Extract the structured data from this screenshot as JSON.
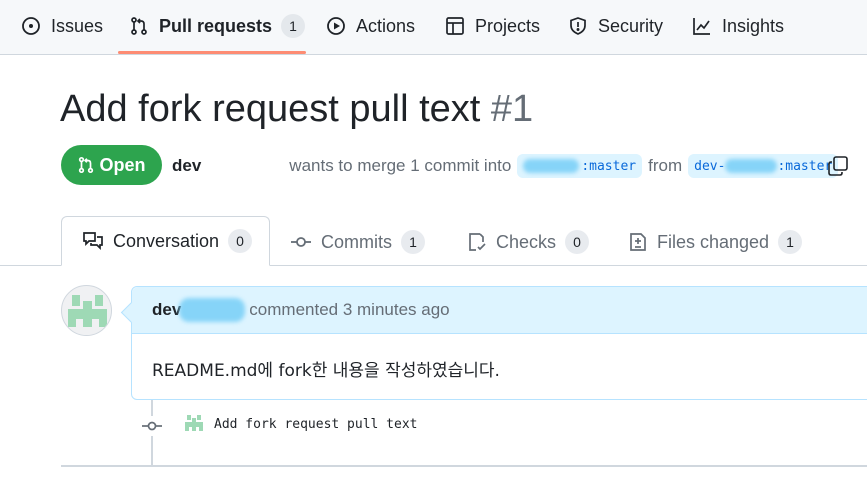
{
  "nav": {
    "items": [
      {
        "label": "Issues",
        "icon": "issue-opened-icon"
      },
      {
        "label": "Pull requests",
        "icon": "git-pull-request-icon",
        "count": "1",
        "selected": true
      },
      {
        "label": "Actions",
        "icon": "play-icon"
      },
      {
        "label": "Projects",
        "icon": "table-icon"
      },
      {
        "label": "Security",
        "icon": "shield-icon"
      },
      {
        "label": "Insights",
        "icon": "graph-icon"
      }
    ]
  },
  "pr": {
    "title": "Add fork request pull text",
    "number": "#1",
    "state": "Open",
    "author": "dev",
    "merge_text": "wants to merge 1 commit into",
    "base_branch": ":master",
    "from_text": "from",
    "head_branch_prefix": "dev-",
    "head_branch_suffix": ":master"
  },
  "tabs": [
    {
      "label": "Conversation",
      "count": "0",
      "icon": "comment-discussion-icon",
      "selected": true
    },
    {
      "label": "Commits",
      "count": "1",
      "icon": "git-commit-icon"
    },
    {
      "label": "Checks",
      "count": "0",
      "icon": "checklist-icon"
    },
    {
      "label": "Files changed",
      "count": "1",
      "icon": "file-diff-icon"
    }
  ],
  "comment": {
    "author": "dev",
    "meta": "commented 3 minutes ago",
    "body": "README.md에 fork한 내용을 작성하였습니다."
  },
  "commit": {
    "message": "Add fork request pull text"
  },
  "colors": {
    "open_green": "#2da44e",
    "accent_underline": "#fd8c73",
    "branch_bg": "#ddf4ff",
    "link_blue": "#0969da",
    "redaction": "#78cff7"
  }
}
